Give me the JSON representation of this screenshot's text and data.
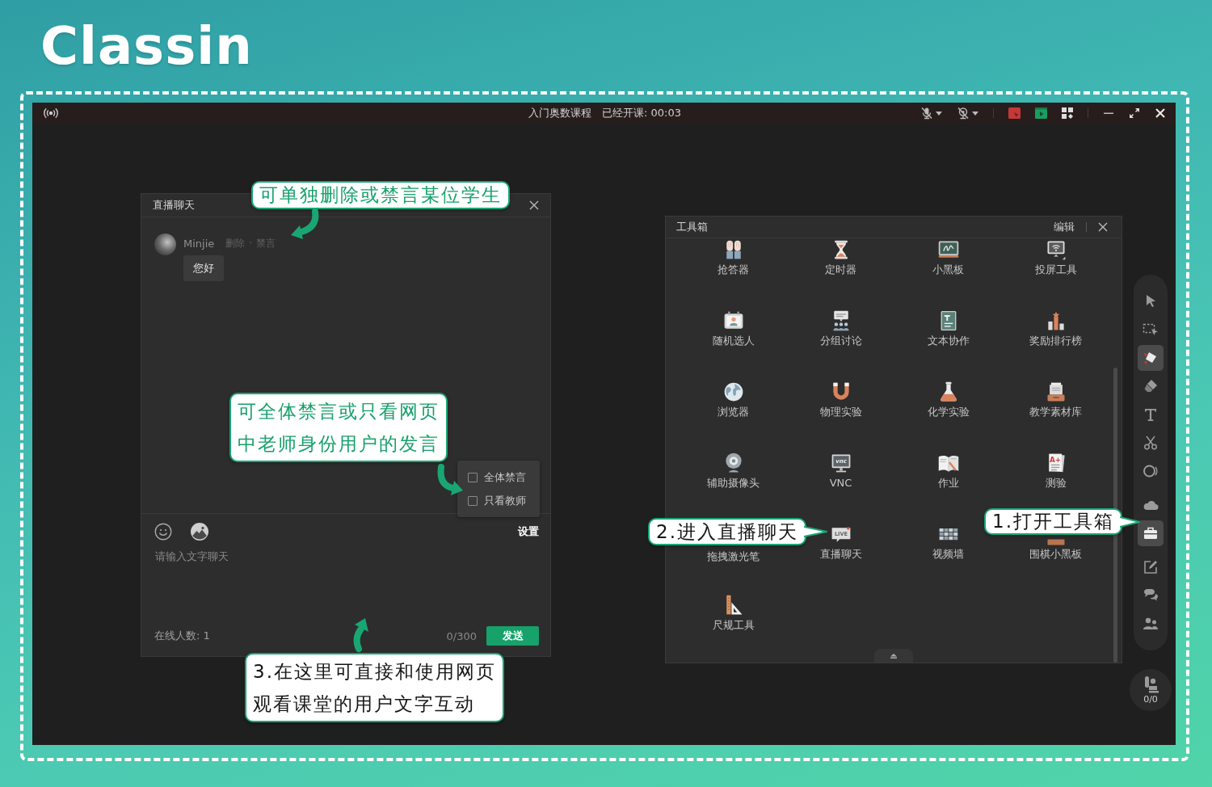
{
  "logo": {
    "text": "Classin"
  },
  "title_bar": {
    "course": "入门奥数课程",
    "elapsed": "已经开课: 00:03",
    "mic": {
      "muted": true
    },
    "camera": {
      "off": true
    }
  },
  "chat_panel": {
    "title": "直播聊天",
    "messages": [
      {
        "author": "Minjie",
        "actions": [
          "删除",
          "禁言"
        ],
        "separator": "·",
        "text": "您好"
      }
    ],
    "settings_menu": {
      "options": [
        {
          "label": "全体禁言",
          "checked": false
        },
        {
          "label": "只看教师",
          "checked": false
        }
      ]
    },
    "settings_button": "设置",
    "input": {
      "placeholder": "请输入文字聊天"
    },
    "online_count": "在线人数: 1",
    "char_count": "0/300",
    "send_button": "发送"
  },
  "toolbox": {
    "title": "工具箱",
    "edit_button": "编辑",
    "tools": [
      {
        "label": "抢答器",
        "kind": "hands"
      },
      {
        "label": "定时器",
        "kind": "hourglass"
      },
      {
        "label": "小黑板",
        "kind": "chalkboard"
      },
      {
        "label": "投屏工具",
        "kind": "cast"
      },
      {
        "label": "随机选人",
        "kind": "card"
      },
      {
        "label": "分组讨论",
        "kind": "group"
      },
      {
        "label": "文本协作",
        "kind": "textdoc"
      },
      {
        "label": "奖励排行榜",
        "kind": "ranking"
      },
      {
        "label": "浏览器",
        "kind": "globe"
      },
      {
        "label": "物理实验",
        "kind": "magnet"
      },
      {
        "label": "化学实验",
        "kind": "flask"
      },
      {
        "label": "教学素材库",
        "kind": "tray"
      },
      {
        "label": "辅助摄像头",
        "kind": "webcam"
      },
      {
        "label": "VNC",
        "kind": "monitor",
        "icon_text": "vnc"
      },
      {
        "label": "作业",
        "kind": "book"
      },
      {
        "label": "测验",
        "kind": "paper",
        "icon_text": "A+"
      },
      {
        "label": "拖拽激光笔",
        "kind": "covered"
      },
      {
        "label": "直播聊天",
        "kind": "live",
        "icon_text": "LIVE"
      },
      {
        "label": "视频墙",
        "kind": "videowall"
      },
      {
        "label": "围棋小黑板",
        "kind": "board"
      },
      {
        "label": "尺规工具",
        "kind": "ruler"
      }
    ]
  },
  "side_toolbar": {
    "groups": [
      {
        "tools": [
          {
            "kind": "pointer",
            "selected": false
          },
          {
            "kind": "select",
            "selected": false
          },
          {
            "kind": "marker",
            "selected": true
          },
          {
            "kind": "eraser",
            "selected": false
          },
          {
            "kind": "text",
            "selected": false
          },
          {
            "kind": "scissors",
            "selected": false
          },
          {
            "kind": "ring",
            "selected": false
          }
        ]
      },
      {
        "tools": [
          {
            "kind": "cloud",
            "selected": false
          },
          {
            "kind": "toolbox",
            "selected": true
          }
        ]
      },
      {
        "tools": [
          {
            "kind": "edit",
            "selected": false
          },
          {
            "kind": "chat",
            "selected": false
          },
          {
            "kind": "users",
            "selected": false
          }
        ]
      }
    ],
    "seat_count": "0/0"
  },
  "annotations": [
    {
      "kind": "note",
      "lines": [
        "可单独删除或禁言某位学生"
      ]
    },
    {
      "kind": "note",
      "lines": [
        "可全体禁言或只看网页",
        "中老师身份用户的发言"
      ]
    },
    {
      "kind": "step",
      "lines": [
        "1.打开工具箱"
      ]
    },
    {
      "kind": "step",
      "lines": [
        "2.进入直播聊天"
      ]
    },
    {
      "kind": "step",
      "lines": [
        "3.在这里可直接和使用网页",
        "观看课堂的用户文字互动"
      ]
    }
  ]
}
